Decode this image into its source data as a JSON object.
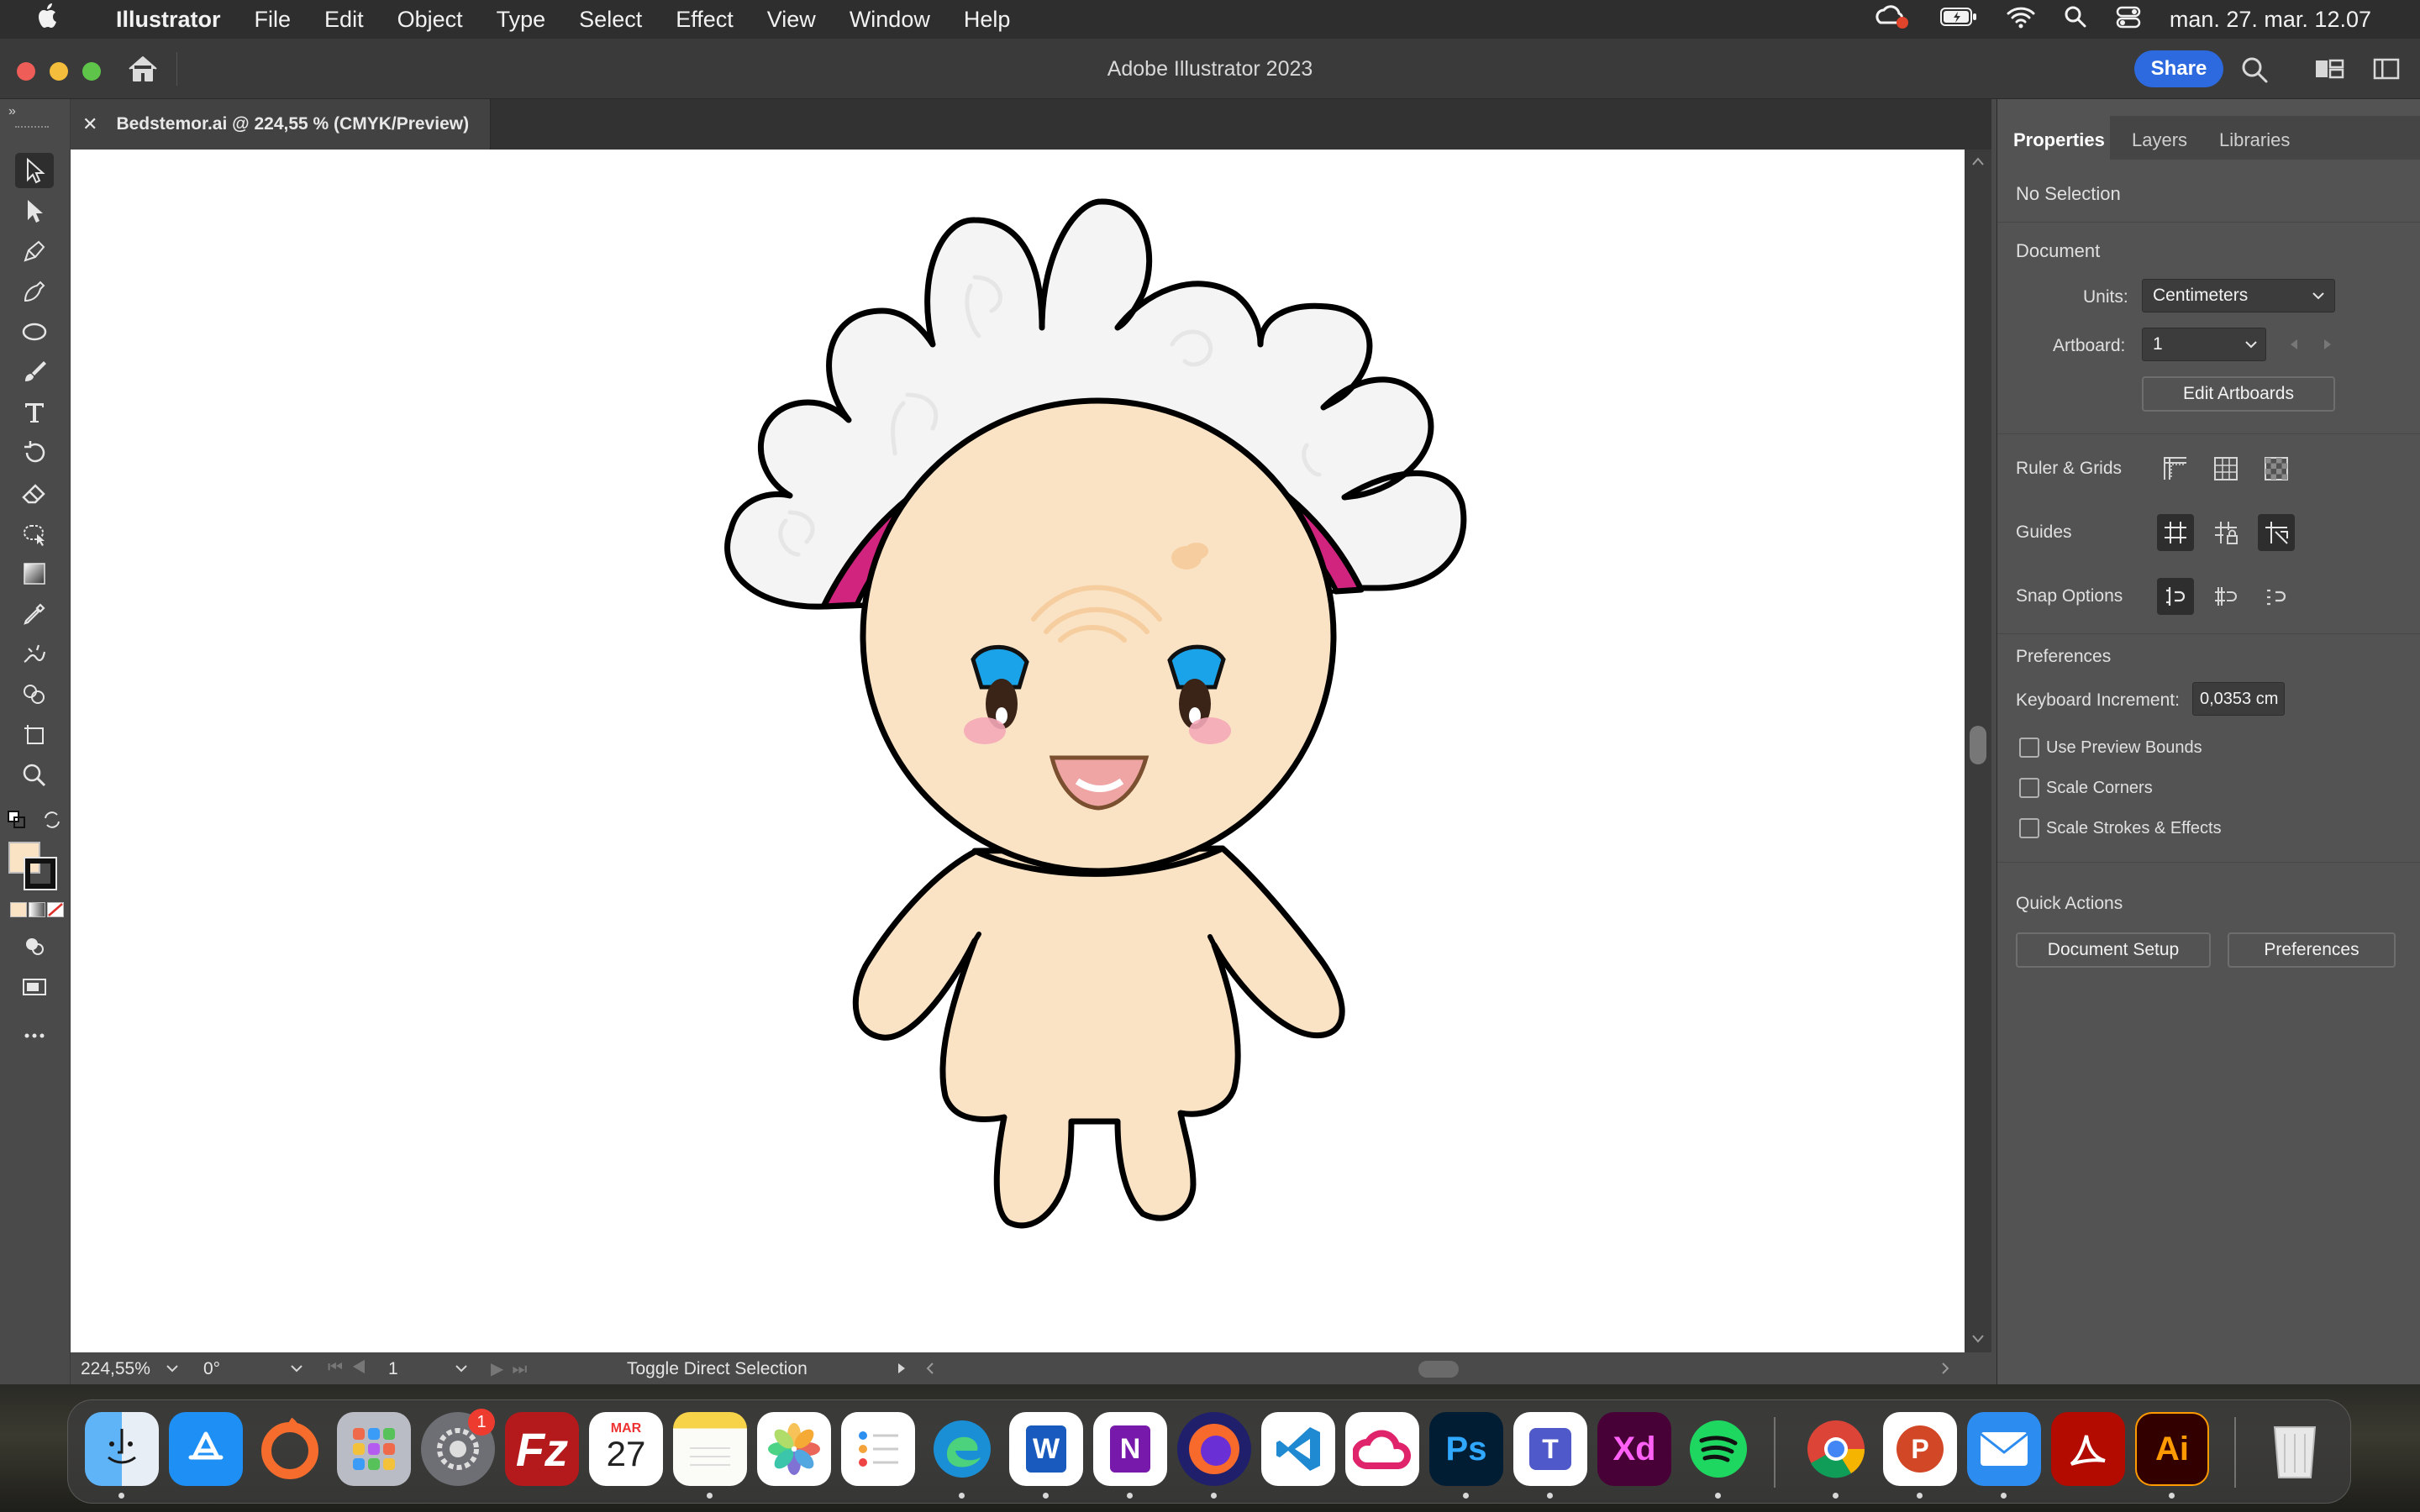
{
  "menubar": {
    "app": "Illustrator",
    "items": [
      "File",
      "Edit",
      "Object",
      "Type",
      "Select",
      "Effect",
      "View",
      "Window",
      "Help"
    ],
    "clock": "man. 27. mar. 12.07"
  },
  "window": {
    "title": "Adobe Illustrator 2023",
    "share_label": "Share"
  },
  "document": {
    "tab_title": "Bedstemor.ai @ 224,55 % (CMYK/Preview)"
  },
  "statusbar": {
    "zoom": "224,55%",
    "rotation": "0°",
    "artboard": "1",
    "tool_hint": "Toggle Direct Selection"
  },
  "panel": {
    "tabs": [
      "Properties",
      "Layers",
      "Libraries"
    ],
    "selection": "No Selection",
    "document_heading": "Document",
    "units_label": "Units:",
    "units_value": "Centimeters",
    "artboard_label": "Artboard:",
    "artboard_value": "1",
    "edit_artboards": "Edit Artboards",
    "ruler_grids": "Ruler & Grids",
    "guides": "Guides",
    "snap_options": "Snap Options",
    "preferences_heading": "Preferences",
    "keyboard_increment_label": "Keyboard Increment:",
    "keyboard_increment_value": "0,0353 cm",
    "checkboxes": [
      "Use Preview Bounds",
      "Scale Corners",
      "Scale Strokes & Effects"
    ],
    "quick_actions": "Quick Actions",
    "document_setup": "Document Setup",
    "preferences_button": "Preferences"
  },
  "dock": {
    "calendar_month": "MAR",
    "calendar_day": "27",
    "settings_badge": "1",
    "labels": {
      "filezilla": "Fz",
      "photoshop": "Ps",
      "xd": "Xd",
      "illustrator": "Ai",
      "word": "W",
      "onenote": "N",
      "powerpoint": "P",
      "teams": "T"
    }
  },
  "colors": {
    "accent": "#2d6ae0",
    "skin": "#fae3c4",
    "headband": "#d0247f",
    "eyes": "#1aa3e8",
    "hair": "#f4f4f4"
  }
}
